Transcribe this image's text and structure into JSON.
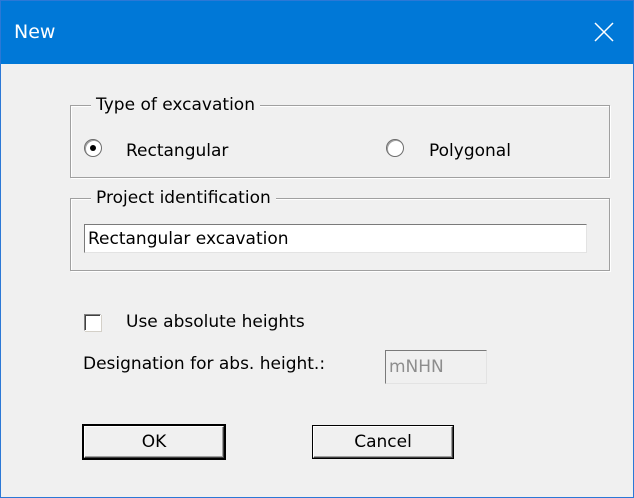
{
  "window": {
    "title": "New"
  },
  "excavation_type": {
    "group_title": "Type of excavation",
    "options": [
      {
        "label": "Rectangular",
        "selected": true
      },
      {
        "label": "Polygonal",
        "selected": false
      }
    ]
  },
  "project": {
    "group_title": "Project identification",
    "value": "Rectangular excavation"
  },
  "heights": {
    "use_absolute_label": "Use absolute heights",
    "use_absolute_checked": false,
    "designation_label": "Designation for abs. height.:",
    "designation_value": "mNHN"
  },
  "buttons": {
    "ok": "OK",
    "cancel": "Cancel"
  },
  "colors": {
    "titlebar": "#0078d7",
    "dialog_bg": "#f0f0f0"
  },
  "icons": {
    "close": "close-icon"
  }
}
